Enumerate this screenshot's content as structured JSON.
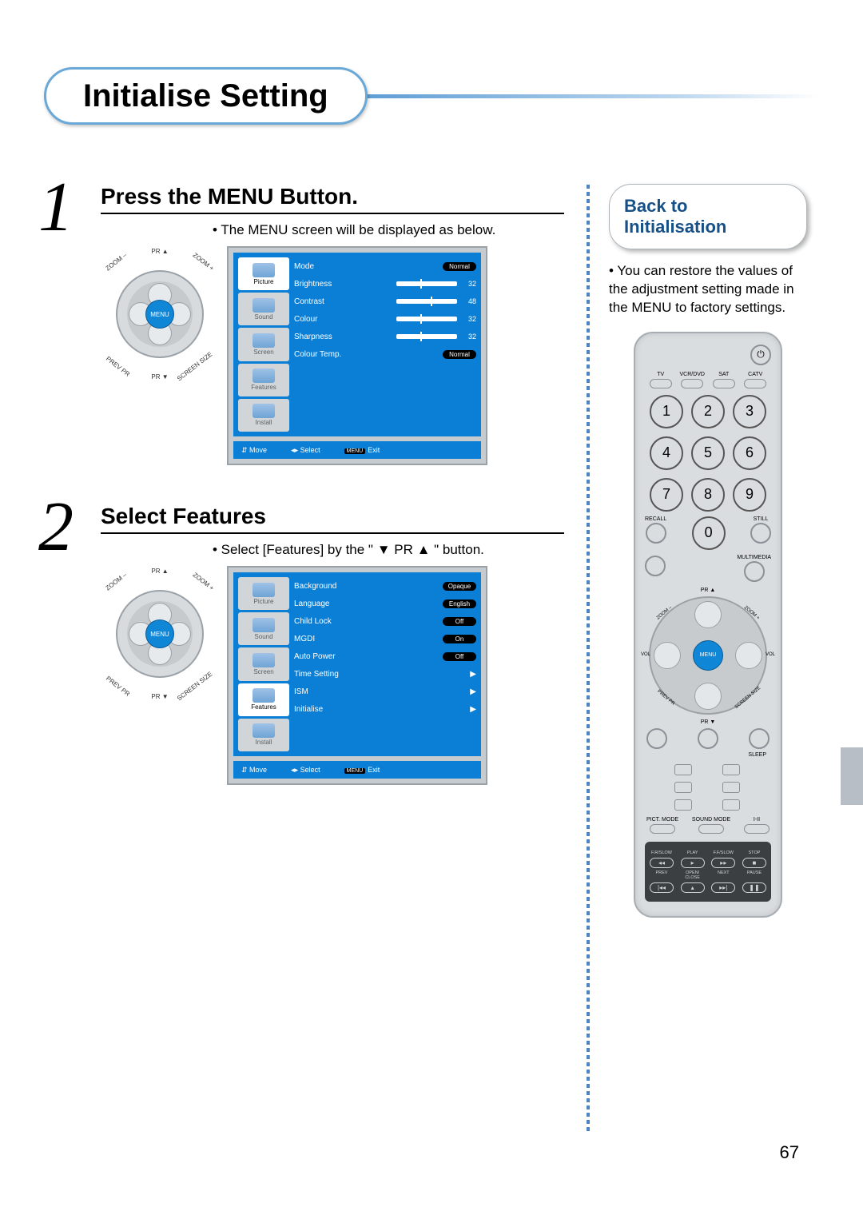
{
  "title": "Initialise Setting",
  "page_number": "67",
  "steps": [
    {
      "num": "1",
      "heading": "Press the MENU Button.",
      "bullet": "The MENU screen will be displayed as below.",
      "sidebar_selected": "Picture",
      "sidebar": [
        "Picture",
        "Sound",
        "Screen",
        "Features",
        "Install"
      ],
      "rows": [
        {
          "k": "Mode",
          "type": "pill",
          "v": "Normal"
        },
        {
          "k": "Brightness",
          "type": "bar",
          "v": "32"
        },
        {
          "k": "Contrast",
          "type": "bar",
          "v": "48"
        },
        {
          "k": "Colour",
          "type": "bar",
          "v": "32"
        },
        {
          "k": "Sharpness",
          "type": "bar",
          "v": "32"
        },
        {
          "k": "Colour Temp.",
          "type": "pill",
          "v": "Normal"
        }
      ],
      "footer": {
        "move": "Move",
        "select": "Select",
        "exit_chip": "MENU",
        "exit": "Exit"
      }
    },
    {
      "num": "2",
      "heading": "Select Features",
      "bullet": "Select [Features] by the \" ▼ PR ▲ \" button.",
      "sidebar_selected": "Features",
      "sidebar": [
        "Picture",
        "Sound",
        "Screen",
        "Features",
        "Install"
      ],
      "rows": [
        {
          "k": "Background",
          "type": "pill",
          "v": "Opaque"
        },
        {
          "k": "Language",
          "type": "pill",
          "v": "English"
        },
        {
          "k": "Child Lock",
          "type": "pill",
          "v": "Off"
        },
        {
          "k": "MGDI",
          "type": "pill",
          "v": "On"
        },
        {
          "k": "Auto Power",
          "type": "pill",
          "v": "Off"
        },
        {
          "k": "Time Setting",
          "type": "tri",
          "v": "▶"
        },
        {
          "k": "ISM",
          "type": "tri",
          "v": "▶"
        },
        {
          "k": "Initialise",
          "type": "tri",
          "v": "▶"
        }
      ],
      "footer": {
        "move": "Move",
        "select": "Select",
        "exit_chip": "MENU",
        "exit": "Exit"
      }
    }
  ],
  "dpad": {
    "top_lbl": "PR ▲",
    "bottom_lbl": "PR ▼",
    "zoom_minus": "ZOOM –",
    "zoom_plus": "ZOOM +",
    "prev": "PREV PR",
    "size": "SCREEN SIZE",
    "vol": "VOL",
    "center": "MENU"
  },
  "right": {
    "back1": "Back to",
    "back2": "Initialisation",
    "restore": "You can restore the values of the adjustment setting made in the MENU to factory settings."
  },
  "remote": {
    "sources": [
      "TV",
      "VCR/DVD",
      "SAT",
      "CATV"
    ],
    "digits": [
      "1",
      "2",
      "3",
      "4",
      "5",
      "6",
      "7",
      "8",
      "9"
    ],
    "zero": "0",
    "recall": "RECALL",
    "still": "STILL",
    "multimedia": "MULTIMEDIA",
    "menu": "MENU",
    "pr_up": "PR ▲",
    "pr_dn": "PR ▼",
    "zoom_m": "ZOOM –",
    "zoom_p": "ZOOM +",
    "prev": "PREV PR",
    "size": "SCREEN SIZE",
    "vol": "VOL",
    "sleep": "SLEEP",
    "pict": "PICT. MODE",
    "sound": "SOUND MODE",
    "iii": "I-II",
    "t_top": [
      "F.R/SLOW",
      "PLAY",
      "F.F/SLOW",
      "STOP"
    ],
    "t_top_ico": [
      "◂◂",
      "▸",
      "▸▸",
      "■"
    ],
    "t_bot": [
      "PREV",
      "OPEN/\nCLOSE",
      "NEXT",
      "PAUSE"
    ],
    "t_bot_ico": [
      "|◂◂",
      "▴",
      "▸▸|",
      "❚❚"
    ]
  }
}
